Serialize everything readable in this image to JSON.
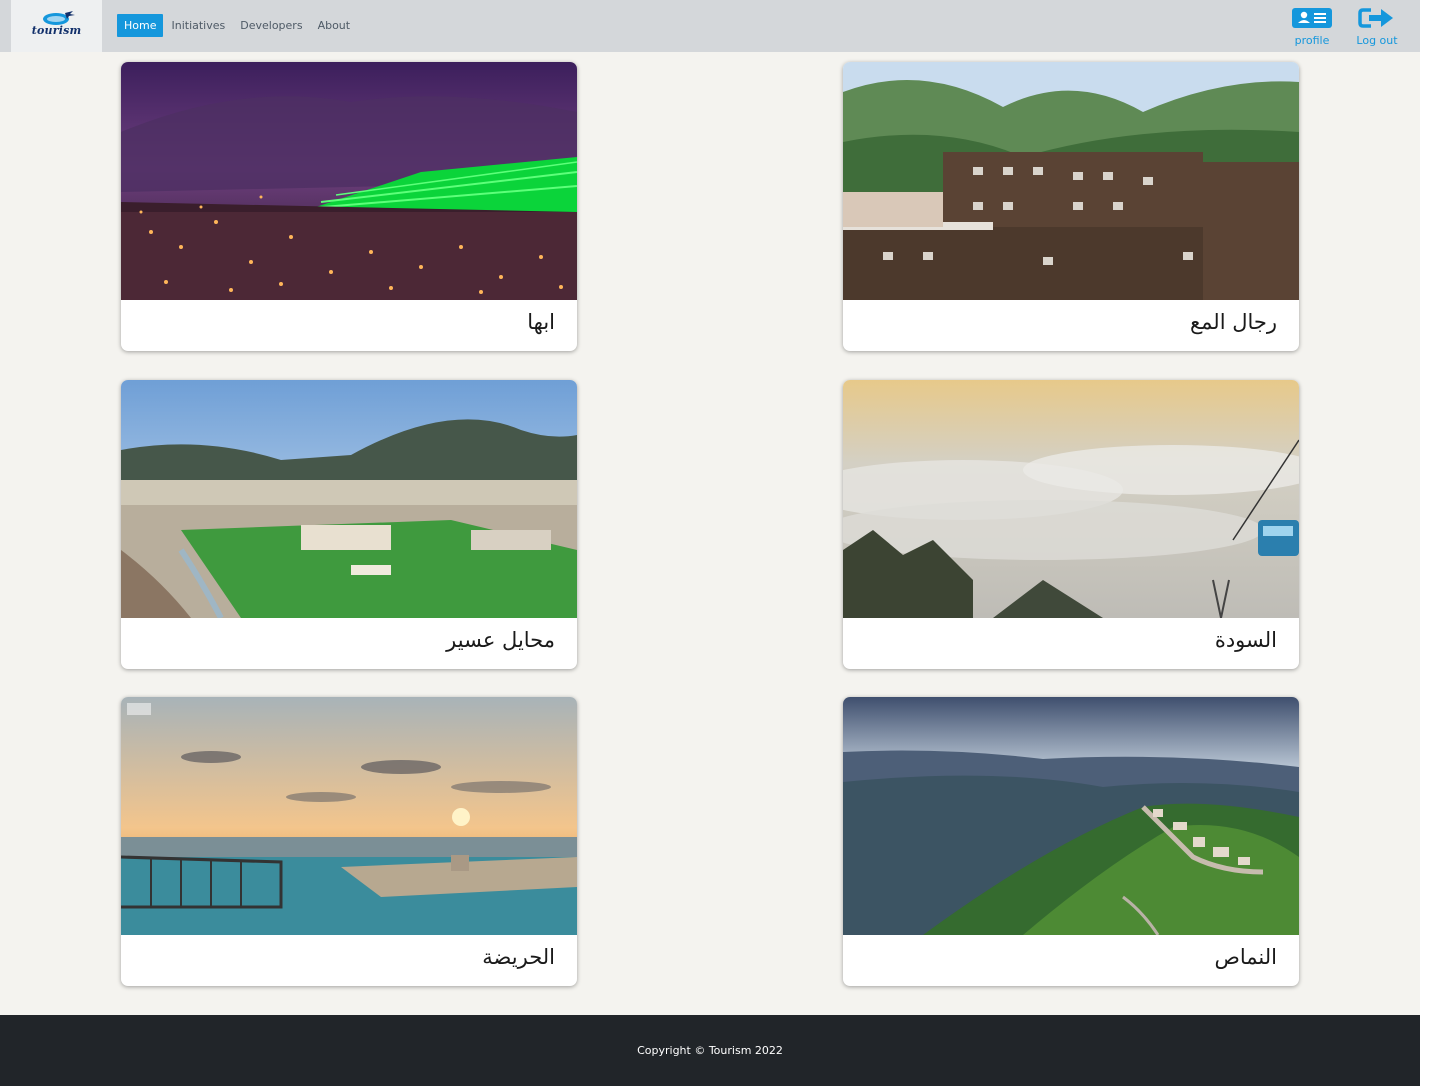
{
  "brand": {
    "name": "tourism"
  },
  "nav": {
    "links": [
      "Home",
      "Initiatives",
      "Developers",
      "About"
    ],
    "active": "Home"
  },
  "actions": {
    "profile_label": "profile",
    "logout_label": "Log out",
    "profile_icon": "profile-card-icon",
    "logout_icon": "logout-arrow-icon"
  },
  "cards": [
    {
      "name": "ابها",
      "photo": "night city with green-lit terraced hills"
    },
    {
      "name": "رجال المع",
      "photo": "stone village beneath green mountains"
    },
    {
      "name": "محايل عسير",
      "photo": "aerial town with park and mountains"
    },
    {
      "name": "السودة",
      "photo": "sea of clouds with cable car"
    },
    {
      "name": "الحريضة",
      "photo": "sunset over sea with railing"
    },
    {
      "name": "النماص",
      "photo": "green mountain valley under cloudy sky"
    }
  ],
  "footer": {
    "copyright": "Copyright © Tourism 2022"
  },
  "colors": {
    "accent": "#1597dc",
    "navbar": "#d4d7da",
    "footer": "#212529",
    "background": "#f4f3ef"
  }
}
